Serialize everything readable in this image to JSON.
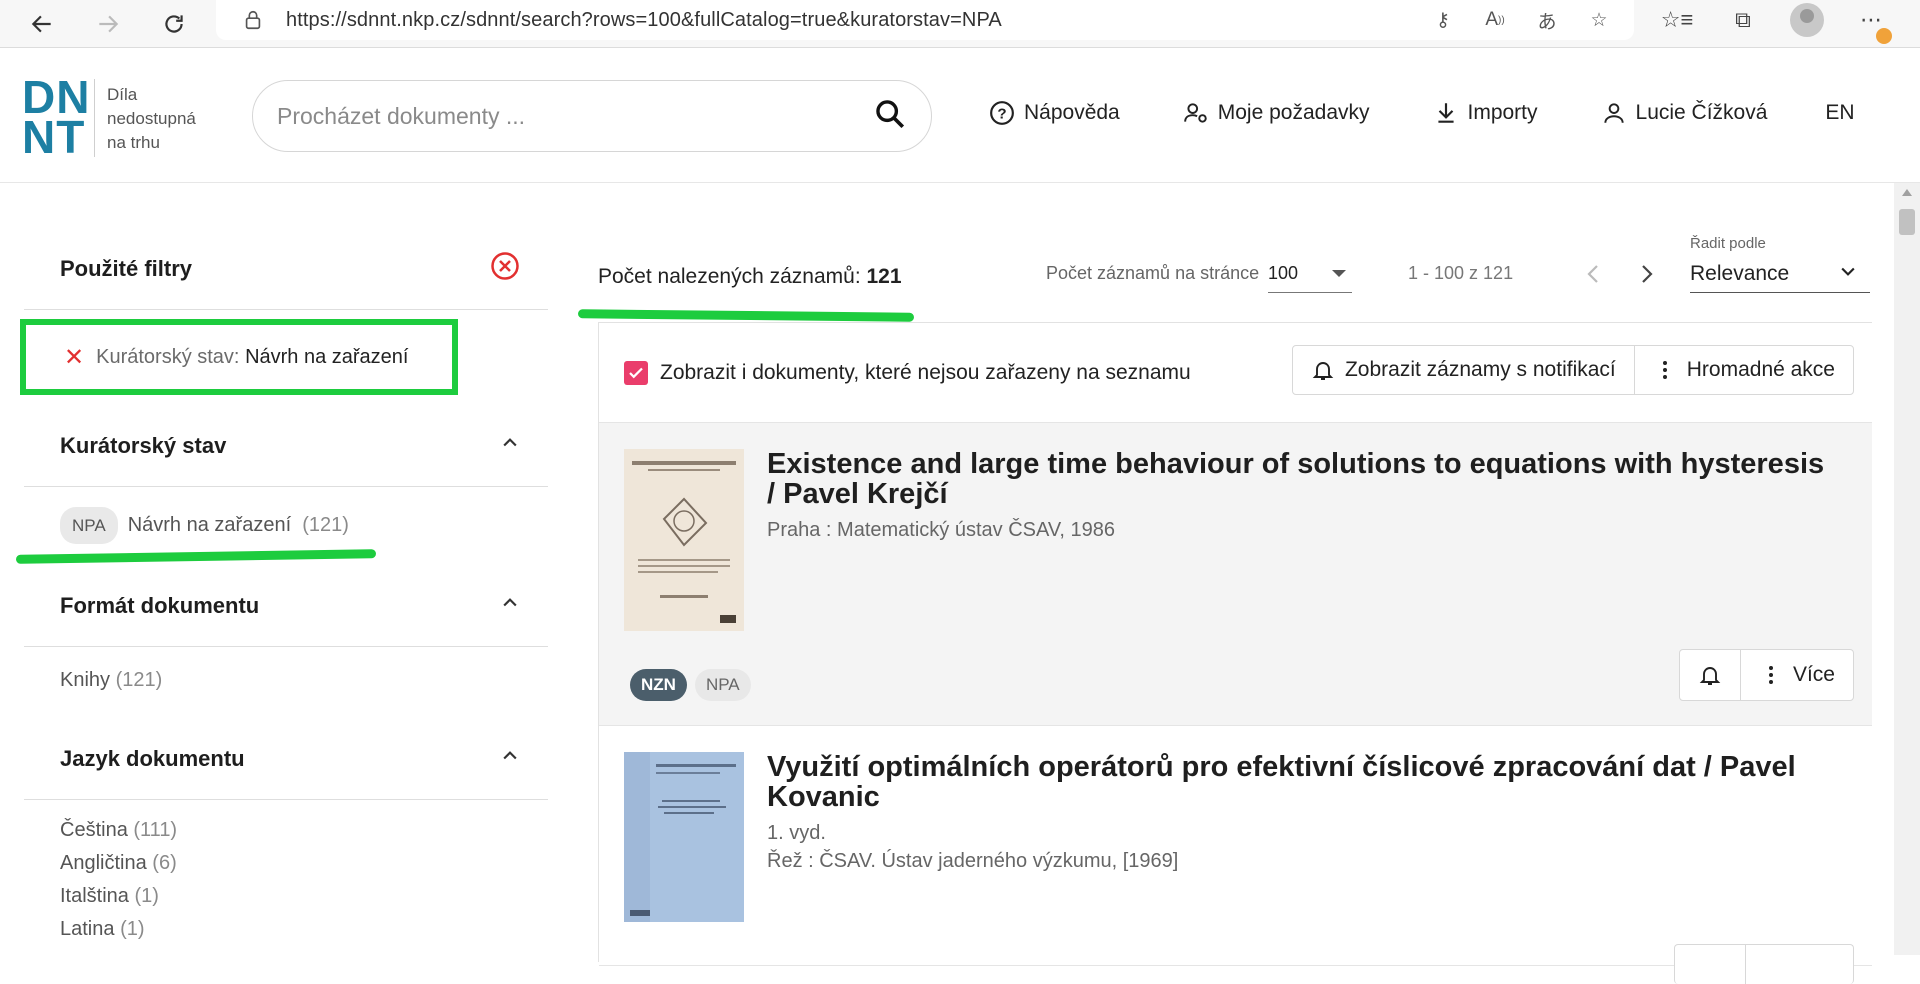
{
  "browser": {
    "url": "https://sdnnt.nkp.cz/sdnnt/search?rows=100&fullCatalog=true&kuratorstav=NPA",
    "icons": [
      "back-icon",
      "forward-icon",
      "refresh-icon",
      "lock-icon",
      "key-icon",
      "read-aloud-icon",
      "translate-icon",
      "add-favorite-icon",
      "favorites-icon",
      "collections-icon",
      "profile-icon",
      "more-icon"
    ]
  },
  "header": {
    "logo_mark_line1": "DN",
    "logo_mark_line2": "NT",
    "logo_text_1": "Díla",
    "logo_text_2": "nedostupná",
    "logo_text_3": "na trhu",
    "search_placeholder": "Procházet dokumenty ...",
    "nav": {
      "help": "Nápověda",
      "requests": "Moje požadavky",
      "imports": "Importy",
      "user": "Lucie Čížková",
      "lang": "EN"
    }
  },
  "sidebar": {
    "applied_title": "Použité filtry",
    "applied_filter_label": "Kurátorský stav:",
    "applied_filter_value": "Návrh na zařazení",
    "curator_title": "Kurátorský stav",
    "curator_chip": "NPA",
    "curator_value": "Návrh na zařazení",
    "curator_count": "(121)",
    "format_title": "Formát dokumentu",
    "format_value": "Knihy",
    "format_count": "(121)",
    "language_title": "Jazyk dokumentu",
    "languages": [
      {
        "name": "Čeština",
        "count": "(111)"
      },
      {
        "name": "Angličtina",
        "count": "(6)"
      },
      {
        "name": "Italština",
        "count": "(1)"
      },
      {
        "name": "Latina",
        "count": "(1)"
      }
    ]
  },
  "results": {
    "count_label": "Počet nalezených záznamů:",
    "count_value": "121",
    "per_page_label": "Počet záznamů na stránce",
    "per_page_value": "100",
    "range": "1 - 100 z 121",
    "sort_label": "Řadit podle",
    "sort_value": "Relevance",
    "show_all_label": "Zobrazit i dokumenty, které nejsou zařazeny na seznamu",
    "notif_button": "Zobrazit záznamy s notifikací",
    "bulk_button": "Hromadné akce",
    "items": [
      {
        "title": "Existence and large time behaviour of solutions to equations with hysteresis / Pavel Krejčí",
        "line1": "Praha : Matematický ústav ČSAV, 1986",
        "badges": [
          "NZN",
          "NPA"
        ],
        "more_label": "Více"
      },
      {
        "title": "Využití optimálních operátorů pro efektivní číslicové zpracování dat / Pavel Kovanic",
        "line1": "1. vyd.",
        "line2": "Řež : ČSAV. Ústav jaderného výzkumu, [1969]"
      }
    ]
  },
  "colors": {
    "brand": "#1d7fa3",
    "highlight": "#1dcc3e",
    "checkbox": "#ea3d6b",
    "badge_dark": "#4b5e6b"
  }
}
